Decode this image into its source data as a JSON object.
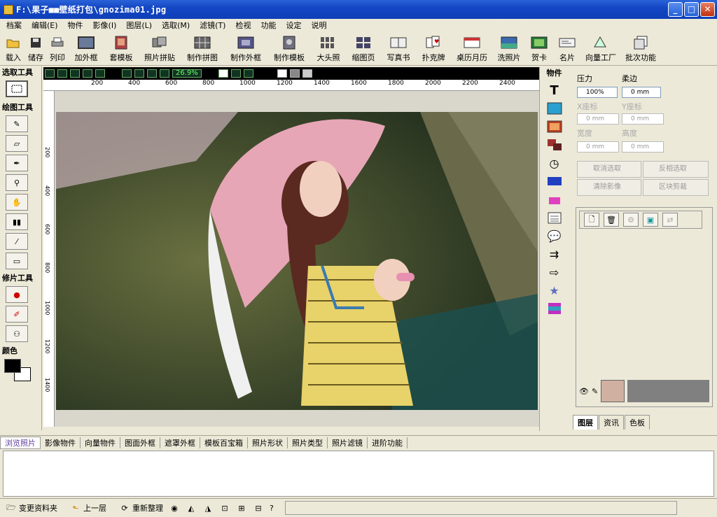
{
  "window": {
    "title": "F:\\果子■■壁纸打包\\gnozima01.jpg",
    "buttons": {
      "min": "_",
      "max": "□",
      "close": "✕"
    }
  },
  "menu": [
    "档案",
    "编辑(E)",
    "物件",
    "影像(I)",
    "图层(L)",
    "选取(M)",
    "滤镜(T)",
    "检视",
    "功能",
    "设定",
    "说明"
  ],
  "toolbar": [
    {
      "label": "载入",
      "icon": "folder-open-icon"
    },
    {
      "label": "储存",
      "icon": "disk-icon"
    },
    {
      "label": "列印",
      "icon": "printer-icon"
    },
    {
      "label": "加外框",
      "icon": "frame-icon"
    },
    {
      "label": "套模板",
      "icon": "template-icon"
    },
    {
      "label": "照片拼贴",
      "icon": "collage-icon"
    },
    {
      "label": "制作拼图",
      "icon": "puzzle-icon"
    },
    {
      "label": "制作外框",
      "icon": "make-frame-icon"
    },
    {
      "label": "制作模板",
      "icon": "make-template-icon"
    },
    {
      "label": "大头照",
      "icon": "id-photo-icon"
    },
    {
      "label": "缩图页",
      "icon": "thumbnail-icon"
    },
    {
      "label": "写真书",
      "icon": "photobook-icon"
    },
    {
      "label": "扑克牌",
      "icon": "poker-icon"
    },
    {
      "label": "桌历月历",
      "icon": "calendar-icon"
    },
    {
      "label": "洗照片",
      "icon": "print-photo-icon"
    },
    {
      "label": "贺卡",
      "icon": "greeting-card-icon"
    },
    {
      "label": "名片",
      "icon": "business-card-icon"
    },
    {
      "label": "向量工厂",
      "icon": "vector-icon"
    },
    {
      "label": "批次功能",
      "icon": "batch-icon"
    }
  ],
  "left": {
    "select_tools_label": "选取工具",
    "draw_tools_label": "绘图工具",
    "retouch_tools_label": "修片工具",
    "color_label": "颜色",
    "colors": {
      "fg": "#000000",
      "bg": "#ffffff"
    }
  },
  "canvas": {
    "zoom": "26.9%",
    "ruler_h": [
      "200",
      "400",
      "600",
      "800",
      "1000",
      "1200",
      "1400",
      "1600",
      "1800",
      "2000",
      "2200",
      "2400"
    ],
    "ruler_v": [
      "200",
      "400",
      "600",
      "800",
      "1000",
      "1200",
      "1400"
    ]
  },
  "objects": {
    "label": "物件"
  },
  "props": {
    "pressure_label": "压力",
    "pressure_value": "100%",
    "soft_label": "柔边",
    "soft_value": "0 mm",
    "hvert_label": "X座标",
    "hhoriz_label": "Y座标",
    "x_value": "0 mm",
    "y_value": "0 mm",
    "w_label": "宽度",
    "h_label": "高度",
    "w_value": "0 mm",
    "h_value": "0 mm",
    "btn_cancel_select": "取消选取",
    "btn_inverse_select": "反相选取",
    "btn_clear_image": "清除影像",
    "btn_crop": "区块剪裁"
  },
  "right_tabs": [
    "图层",
    "资讯",
    "色板"
  ],
  "bottom_tabs": [
    "浏览照片",
    "影像物件",
    "向量物件",
    "图面外框",
    "遮罩外框",
    "模板百宝箱",
    "照片形状",
    "照片类型",
    "照片滤镜",
    "进阶功能"
  ],
  "status": {
    "change_folder": "变更资料夹",
    "up_level": "上一层",
    "refresh": "重新整理",
    "help": "?"
  }
}
